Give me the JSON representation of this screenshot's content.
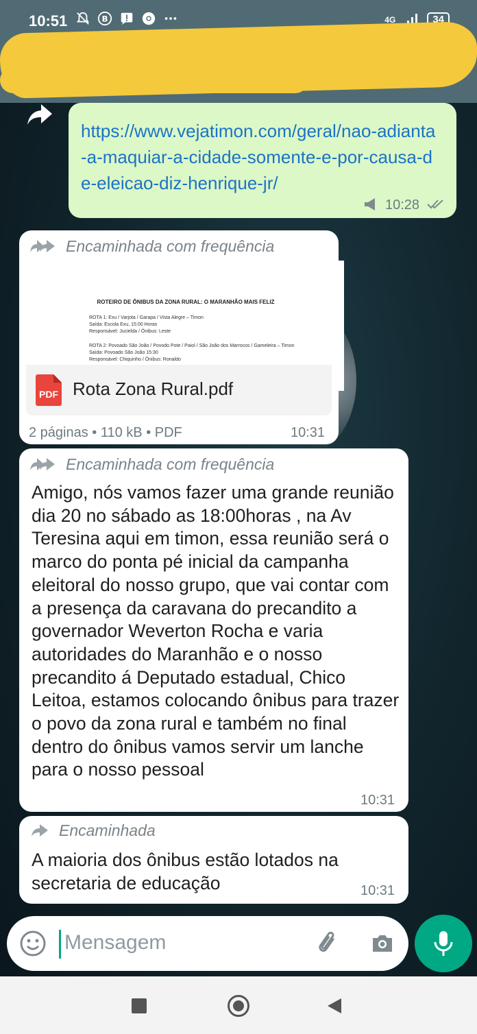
{
  "status_bar": {
    "time": "10:51",
    "network": "4G",
    "battery": "34",
    "icons": [
      "bell-off-icon",
      "b-badge-icon",
      "alert-icon",
      "chrome-icon",
      "more-icon"
    ]
  },
  "messages": [
    {
      "type": "link",
      "direction": "outgoing",
      "text": "https://www.vejatimon.com/geral/nao-adianta-a-maquiar-a-cidade-somente-e-por-causa-de-eleicao-diz-henrique-jr/",
      "time": "10:28"
    },
    {
      "type": "document",
      "direction": "incoming",
      "forwarded_label": "Encaminhada com frequência",
      "preview": {
        "title": "ROTEIRO DE ÔNIBUS DA ZONA RURAL: O MARANHÃO MAIS FELIZ",
        "lines": [
          "ROTA 1: Exu / Varjota / Garapa / Vista Alegre – Timon",
          "Saída: Escola Exu, 15:00 Horas",
          "Responsável: Jucielda / Ônibus: Leste",
          "ROTA 2: Povoado São João / Povodo Pote / Paiol / São João dos Marrocos / Gameleira – Timon",
          "Saída: Povoado São João 15:30",
          "Responsável: Chiquinho / Ônibus: Ronaldo"
        ]
      },
      "file_icon_label": "PDF",
      "file_name": "Rota Zona Rural.pdf",
      "file_meta": "2 páginas • 110 kB • PDF",
      "time": "10:31"
    },
    {
      "type": "text",
      "direction": "incoming",
      "forwarded_label": "Encaminhada com frequência",
      "text": "Amigo, nós vamos fazer uma grande reunião dia 20 no sábado as 18:00horas , na Av Teresina aqui em timon, essa reunião será o marco do ponta pé inicial da campanha eleitoral do nosso grupo, que vai contar com a presença da caravana do precandito a governador Weverton Rocha e varia autoridades do Maranhão e o nosso precandito á Deputado estadual, Chico Leitoa, estamos colocando ônibus para trazer o povo da zona rural e também no final dentro do ônibus vamos servir um lanche para o nosso pessoal",
      "time": "10:31"
    },
    {
      "type": "text",
      "direction": "incoming",
      "forwarded_label": "Encaminhada",
      "text": "A maioria dos ônibus estão lotados na secretaria de educação",
      "time": "10:31"
    }
  ],
  "composer": {
    "placeholder": "Mensagem"
  },
  "colors": {
    "outgoing_bubble": "#dcf8c6",
    "incoming_bubble": "#ffffff",
    "accent": "#00a884",
    "link": "#1b73c8"
  }
}
